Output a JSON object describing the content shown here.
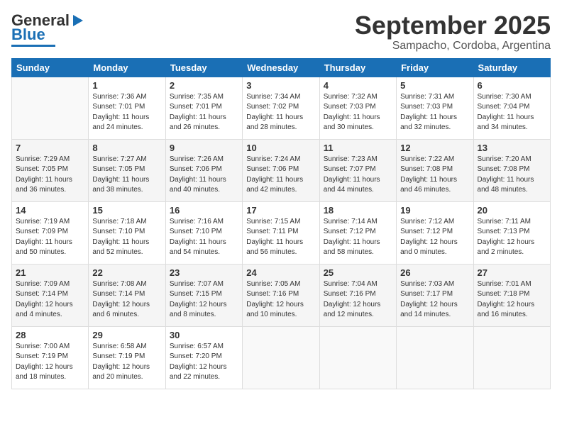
{
  "header": {
    "logo_general": "General",
    "logo_blue": "Blue",
    "month": "September 2025",
    "location": "Sampacho, Cordoba, Argentina"
  },
  "weekdays": [
    "Sunday",
    "Monday",
    "Tuesday",
    "Wednesday",
    "Thursday",
    "Friday",
    "Saturday"
  ],
  "weeks": [
    [
      {
        "day": "",
        "sunrise": "",
        "sunset": "",
        "daylight": ""
      },
      {
        "day": "1",
        "sunrise": "Sunrise: 7:36 AM",
        "sunset": "Sunset: 7:01 PM",
        "daylight": "Daylight: 11 hours and 24 minutes."
      },
      {
        "day": "2",
        "sunrise": "Sunrise: 7:35 AM",
        "sunset": "Sunset: 7:01 PM",
        "daylight": "Daylight: 11 hours and 26 minutes."
      },
      {
        "day": "3",
        "sunrise": "Sunrise: 7:34 AM",
        "sunset": "Sunset: 7:02 PM",
        "daylight": "Daylight: 11 hours and 28 minutes."
      },
      {
        "day": "4",
        "sunrise": "Sunrise: 7:32 AM",
        "sunset": "Sunset: 7:03 PM",
        "daylight": "Daylight: 11 hours and 30 minutes."
      },
      {
        "day": "5",
        "sunrise": "Sunrise: 7:31 AM",
        "sunset": "Sunset: 7:03 PM",
        "daylight": "Daylight: 11 hours and 32 minutes."
      },
      {
        "day": "6",
        "sunrise": "Sunrise: 7:30 AM",
        "sunset": "Sunset: 7:04 PM",
        "daylight": "Daylight: 11 hours and 34 minutes."
      }
    ],
    [
      {
        "day": "7",
        "sunrise": "Sunrise: 7:29 AM",
        "sunset": "Sunset: 7:05 PM",
        "daylight": "Daylight: 11 hours and 36 minutes."
      },
      {
        "day": "8",
        "sunrise": "Sunrise: 7:27 AM",
        "sunset": "Sunset: 7:05 PM",
        "daylight": "Daylight: 11 hours and 38 minutes."
      },
      {
        "day": "9",
        "sunrise": "Sunrise: 7:26 AM",
        "sunset": "Sunset: 7:06 PM",
        "daylight": "Daylight: 11 hours and 40 minutes."
      },
      {
        "day": "10",
        "sunrise": "Sunrise: 7:24 AM",
        "sunset": "Sunset: 7:06 PM",
        "daylight": "Daylight: 11 hours and 42 minutes."
      },
      {
        "day": "11",
        "sunrise": "Sunrise: 7:23 AM",
        "sunset": "Sunset: 7:07 PM",
        "daylight": "Daylight: 11 hours and 44 minutes."
      },
      {
        "day": "12",
        "sunrise": "Sunrise: 7:22 AM",
        "sunset": "Sunset: 7:08 PM",
        "daylight": "Daylight: 11 hours and 46 minutes."
      },
      {
        "day": "13",
        "sunrise": "Sunrise: 7:20 AM",
        "sunset": "Sunset: 7:08 PM",
        "daylight": "Daylight: 11 hours and 48 minutes."
      }
    ],
    [
      {
        "day": "14",
        "sunrise": "Sunrise: 7:19 AM",
        "sunset": "Sunset: 7:09 PM",
        "daylight": "Daylight: 11 hours and 50 minutes."
      },
      {
        "day": "15",
        "sunrise": "Sunrise: 7:18 AM",
        "sunset": "Sunset: 7:10 PM",
        "daylight": "Daylight: 11 hours and 52 minutes."
      },
      {
        "day": "16",
        "sunrise": "Sunrise: 7:16 AM",
        "sunset": "Sunset: 7:10 PM",
        "daylight": "Daylight: 11 hours and 54 minutes."
      },
      {
        "day": "17",
        "sunrise": "Sunrise: 7:15 AM",
        "sunset": "Sunset: 7:11 PM",
        "daylight": "Daylight: 11 hours and 56 minutes."
      },
      {
        "day": "18",
        "sunrise": "Sunrise: 7:14 AM",
        "sunset": "Sunset: 7:12 PM",
        "daylight": "Daylight: 11 hours and 58 minutes."
      },
      {
        "day": "19",
        "sunrise": "Sunrise: 7:12 AM",
        "sunset": "Sunset: 7:12 PM",
        "daylight": "Daylight: 12 hours and 0 minutes."
      },
      {
        "day": "20",
        "sunrise": "Sunrise: 7:11 AM",
        "sunset": "Sunset: 7:13 PM",
        "daylight": "Daylight: 12 hours and 2 minutes."
      }
    ],
    [
      {
        "day": "21",
        "sunrise": "Sunrise: 7:09 AM",
        "sunset": "Sunset: 7:14 PM",
        "daylight": "Daylight: 12 hours and 4 minutes."
      },
      {
        "day": "22",
        "sunrise": "Sunrise: 7:08 AM",
        "sunset": "Sunset: 7:14 PM",
        "daylight": "Daylight: 12 hours and 6 minutes."
      },
      {
        "day": "23",
        "sunrise": "Sunrise: 7:07 AM",
        "sunset": "Sunset: 7:15 PM",
        "daylight": "Daylight: 12 hours and 8 minutes."
      },
      {
        "day": "24",
        "sunrise": "Sunrise: 7:05 AM",
        "sunset": "Sunset: 7:16 PM",
        "daylight": "Daylight: 12 hours and 10 minutes."
      },
      {
        "day": "25",
        "sunrise": "Sunrise: 7:04 AM",
        "sunset": "Sunset: 7:16 PM",
        "daylight": "Daylight: 12 hours and 12 minutes."
      },
      {
        "day": "26",
        "sunrise": "Sunrise: 7:03 AM",
        "sunset": "Sunset: 7:17 PM",
        "daylight": "Daylight: 12 hours and 14 minutes."
      },
      {
        "day": "27",
        "sunrise": "Sunrise: 7:01 AM",
        "sunset": "Sunset: 7:18 PM",
        "daylight": "Daylight: 12 hours and 16 minutes."
      }
    ],
    [
      {
        "day": "28",
        "sunrise": "Sunrise: 7:00 AM",
        "sunset": "Sunset: 7:19 PM",
        "daylight": "Daylight: 12 hours and 18 minutes."
      },
      {
        "day": "29",
        "sunrise": "Sunrise: 6:58 AM",
        "sunset": "Sunset: 7:19 PM",
        "daylight": "Daylight: 12 hours and 20 minutes."
      },
      {
        "day": "30",
        "sunrise": "Sunrise: 6:57 AM",
        "sunset": "Sunset: 7:20 PM",
        "daylight": "Daylight: 12 hours and 22 minutes."
      },
      {
        "day": "",
        "sunrise": "",
        "sunset": "",
        "daylight": ""
      },
      {
        "day": "",
        "sunrise": "",
        "sunset": "",
        "daylight": ""
      },
      {
        "day": "",
        "sunrise": "",
        "sunset": "",
        "daylight": ""
      },
      {
        "day": "",
        "sunrise": "",
        "sunset": "",
        "daylight": ""
      }
    ]
  ]
}
